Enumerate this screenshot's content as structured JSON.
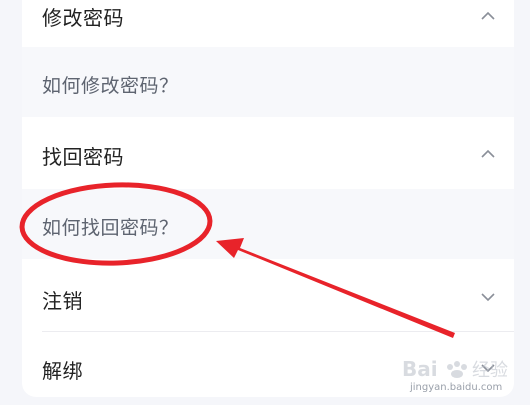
{
  "sections": [
    {
      "title": "修改密码",
      "expanded": true,
      "answer": "如何修改密码？"
    },
    {
      "title": "找回密码",
      "expanded": true,
      "answer": "如何找回密码？"
    },
    {
      "title": "注销",
      "expanded": false
    },
    {
      "title": "解绑",
      "expanded": false
    }
  ],
  "icons": {
    "expanded": "chevron-up-icon",
    "collapsed": "chevron-down-icon"
  },
  "annotation_color": "#e8232a",
  "watermark": {
    "text": "jingyan.baidu.com",
    "logo_lettering": "Bai du 经验"
  }
}
